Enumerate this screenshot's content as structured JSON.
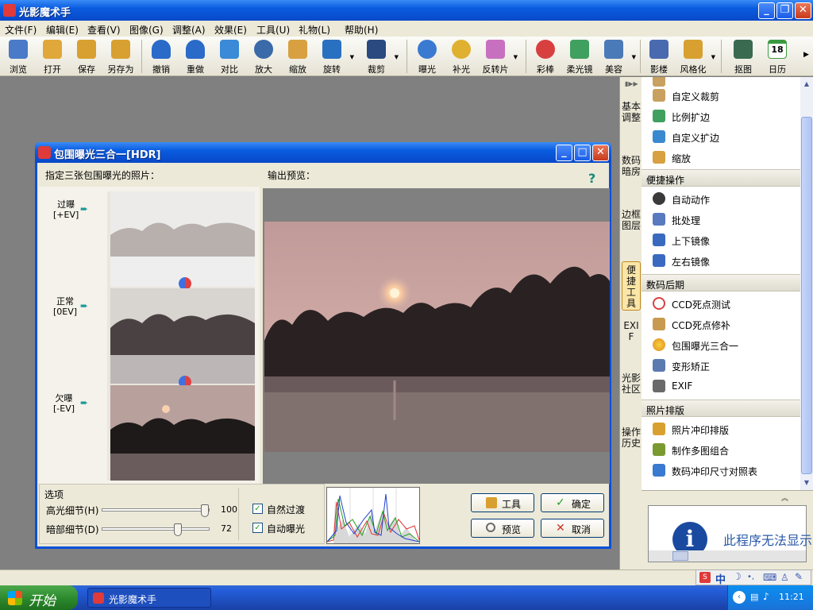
{
  "app": {
    "title": "光影魔术手"
  },
  "menu": [
    "文件(F)",
    "编辑(E)",
    "查看(V)",
    "图像(G)",
    "调整(A)",
    "效果(E)",
    "工具(U)",
    "礼物(L)",
    "帮助(H)"
  ],
  "toolbar": {
    "items": [
      {
        "label": "浏览",
        "icon": "browse-icon",
        "color": "#4a7ac8"
      },
      {
        "label": "打开",
        "icon": "open-folder-icon",
        "color": "#e0a83a"
      },
      {
        "label": "保存",
        "icon": "save-icon",
        "color": "#d8a030"
      },
      {
        "label": "另存为",
        "icon": "save-as-icon",
        "color": "#d8a030"
      },
      {
        "label": "撤销",
        "icon": "undo-icon",
        "color": "#2a6ac8"
      },
      {
        "label": "重做",
        "icon": "redo-icon",
        "color": "#2a6ac8"
      },
      {
        "label": "对比",
        "icon": "compare-icon",
        "color": "#3a8ad8"
      },
      {
        "label": "放大",
        "icon": "zoom-in-icon",
        "color": "#3a6aa8"
      },
      {
        "label": "缩放",
        "icon": "resize-icon",
        "color": "#d8a040"
      },
      {
        "label": "旋转",
        "icon": "rotate-icon",
        "color": "#2a70c0"
      },
      {
        "label": "裁剪",
        "icon": "crop-icon",
        "color": "#2a4a80"
      },
      {
        "label": "曝光",
        "icon": "exposure-icon",
        "color": "#3a7ad0"
      },
      {
        "label": "补光",
        "icon": "fill-light-icon",
        "color": "#e0b030"
      },
      {
        "label": "反转片",
        "icon": "reversal-film-icon",
        "color": "#c870c0"
      },
      {
        "label": "彩棒",
        "icon": "color-wand-icon",
        "color": "#d84040"
      },
      {
        "label": "柔光镜",
        "icon": "soft-filter-icon",
        "color": "#40a060"
      },
      {
        "label": "美容",
        "icon": "beauty-icon",
        "color": "#4a7ab8"
      },
      {
        "label": "影楼",
        "icon": "studio-icon",
        "color": "#4a6ab0"
      },
      {
        "label": "风格化",
        "icon": "stylize-icon",
        "color": "#d8a030"
      },
      {
        "label": "抠图",
        "icon": "cutout-icon",
        "color": "#3a6a50"
      },
      {
        "label": "日历",
        "icon": "calendar-icon",
        "color": "#3a9a40"
      }
    ],
    "calendar_day": "18"
  },
  "side_tabs": [
    "基本调整",
    "数码暗房",
    "边框图层",
    "便捷工具",
    "EXIF",
    "光影社区",
    "操作历史"
  ],
  "panel": {
    "top_items": [
      {
        "label": "自定义裁剪",
        "icon": "custom-crop-icon",
        "color": "#c8a060"
      },
      {
        "label": "比例扩边",
        "icon": "ratio-extend-icon",
        "color": "#40a060"
      },
      {
        "label": "自定义扩边",
        "icon": "custom-extend-icon",
        "color": "#3a8ad0"
      },
      {
        "label": "缩放",
        "icon": "resize-icon",
        "color": "#d8a040"
      }
    ],
    "sections": [
      {
        "title": "便捷操作",
        "items": [
          {
            "label": "自动动作",
            "icon": "auto-action-icon",
            "color": "#3a3a3a"
          },
          {
            "label": "批处理",
            "icon": "batch-icon",
            "color": "#5a7ac0"
          },
          {
            "label": "上下镜像",
            "icon": "flip-vertical-icon",
            "color": "#3a6ac0"
          },
          {
            "label": "左右镜像",
            "icon": "flip-horizontal-icon",
            "color": "#3a6ac0"
          }
        ]
      },
      {
        "title": "数码后期",
        "items": [
          {
            "label": "CCD死点测试",
            "icon": "ccd-test-icon",
            "color": "#d84040"
          },
          {
            "label": "CCD死点修补",
            "icon": "ccd-repair-icon",
            "color": "#c89a50"
          },
          {
            "label": "包围曝光三合一",
            "icon": "hdr-icon",
            "color": "#e08a20"
          },
          {
            "label": "变形矫正",
            "icon": "distortion-icon",
            "color": "#5a7ab0"
          },
          {
            "label": "EXIF",
            "icon": "exif-icon",
            "color": "#6a6a6a"
          }
        ]
      },
      {
        "title": "照片排版",
        "items": [
          {
            "label": "照片冲印排版",
            "icon": "print-layout-icon",
            "color": "#d8a030"
          },
          {
            "label": "制作多图组合",
            "icon": "multi-image-icon",
            "color": "#7a9a30"
          },
          {
            "label": "数码冲印尺寸对照表",
            "icon": "size-table-icon",
            "color": "#3a7ad0"
          }
        ]
      }
    ]
  },
  "info": {
    "message": "此程序无法显示"
  },
  "dialog": {
    "title": "包围曝光三合一[HDR]",
    "source_label": "指定三张包围曝光的照片：",
    "preview_label": "输出预览：",
    "ev_rows": [
      {
        "name": "过曝",
        "ev": "[+EV]"
      },
      {
        "name": "正常",
        "ev": "[0EV]"
      },
      {
        "name": "欠曝",
        "ev": "[-EV]"
      }
    ],
    "options": {
      "legend": "选项",
      "highlight_label": "高光细节(H)",
      "highlight_value": 100,
      "shadow_label": "暗部细节(D)",
      "shadow_value": 72,
      "natural_transition": "自然过渡",
      "auto_exposure": "自动曝光"
    },
    "buttons": {
      "tools": "工具",
      "ok": "确定",
      "preview": "预览",
      "cancel": "取消"
    }
  },
  "taskbar": {
    "start": "开始",
    "task": "光影魔术手",
    "clock": "11:21"
  }
}
